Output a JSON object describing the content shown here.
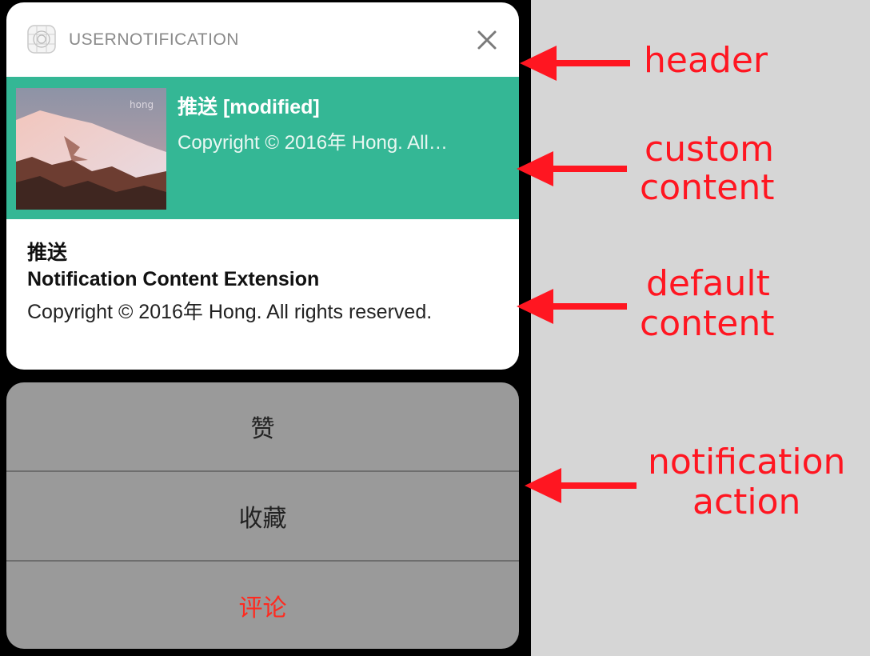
{
  "header": {
    "app_name": "USERNOTIFICATION",
    "app_icon": "app-grid-icon",
    "close_icon": "close-icon"
  },
  "custom_content": {
    "thumbnail_caption": "hong",
    "title": "推送 [modified]",
    "body": "Copyright © 2016年 Hong. All…",
    "background_color": "#34b795"
  },
  "default_content": {
    "title": "推送",
    "subtitle": "Notification Content Extension",
    "body": "Copyright © 2016年 Hong. All rights reserved."
  },
  "actions": [
    {
      "label": "赞",
      "destructive": false
    },
    {
      "label": "收藏",
      "destructive": false
    },
    {
      "label": "评论",
      "destructive": true,
      "color": "#ff2a1f"
    }
  ],
  "annotations": {
    "header": "header",
    "custom_line1": "custom",
    "custom_line2": "content",
    "default_line1": "default",
    "default_line2": "content",
    "action_line1": "notification",
    "action_line2": "action",
    "color": "#ff1621"
  }
}
